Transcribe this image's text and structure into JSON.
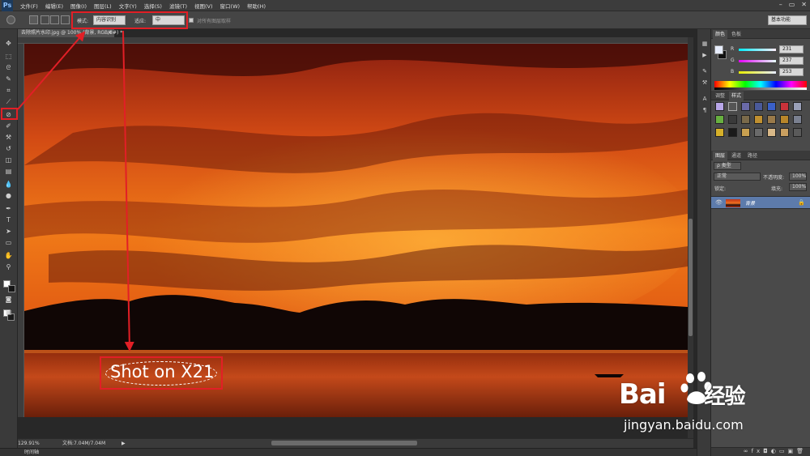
{
  "app": {
    "logo": "Ps"
  },
  "menu": [
    "文件(F)",
    "编辑(E)",
    "图像(I)",
    "图层(L)",
    "文字(Y)",
    "选择(S)",
    "滤镜(T)",
    "视图(V)",
    "窗口(W)",
    "帮助(H)"
  ],
  "window_controls": {
    "minimize": "–",
    "restore": "▭",
    "close": "✕"
  },
  "options_bar": {
    "source_label": "模式:",
    "source_value": "内容识别",
    "adapt_label": "适应:",
    "adapt_value": "中",
    "sample_all_label": "对所有图层取样",
    "workspace": "基本功能"
  },
  "document": {
    "tab_title": "去除照片水印.jpg @ 100% (背景, RGB/8#) *",
    "close": "×",
    "watermark_text": "Shot on X21",
    "zoom": "129.91%",
    "doc_info": "文档:7.04M/7.04M",
    "status_arrow": "▶"
  },
  "bottom_strip": {
    "label": "时间轴"
  },
  "color_panel": {
    "tabs": [
      "颜色",
      "色板"
    ],
    "channels": [
      {
        "label": "R",
        "value": "231",
        "color": "#e7edfd"
      },
      {
        "label": "G",
        "value": "237",
        "color": "#e7edfd"
      },
      {
        "label": "B",
        "value": "253",
        "color": "#e7edfd"
      }
    ],
    "fg_color": "#e7edfd"
  },
  "styles_panel": {
    "tabs": [
      "调整",
      "样式"
    ]
  },
  "layers_panel": {
    "tabs": [
      "图层",
      "通道",
      "路径"
    ],
    "filter_label": "ρ 类型",
    "blend_mode": "正常",
    "opacity_label": "不透明度:",
    "opacity_value": "100%",
    "lock_label": "锁定:",
    "fill_label": "填充:",
    "fill_value": "100%",
    "layers": [
      {
        "name": "背景",
        "visible": true,
        "locked": true
      }
    ]
  },
  "brand_watermark": {
    "line1": "Bai",
    "line1b": "经验",
    "line2": "jingyan.baidu.com"
  },
  "colors": {
    "accent_red": "#e21f26",
    "panel_bg": "#4a4a4a",
    "layer_selected": "#5d7bab"
  }
}
